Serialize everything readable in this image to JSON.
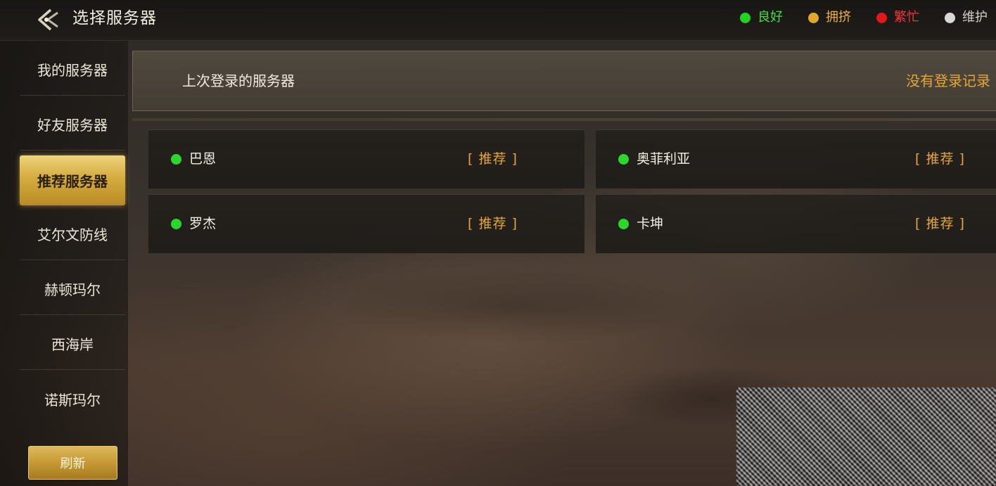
{
  "header": {
    "title": "选择服务器",
    "back_icon": "back-arrow-icon",
    "legend": [
      {
        "label": "良好",
        "color": "#22d422",
        "text_color": "#3fe23f"
      },
      {
        "label": "拥挤",
        "color": "#e0a82a",
        "text_color": "#e8b040"
      },
      {
        "label": "繁忙",
        "color": "#e01818",
        "text_color": "#ee3a3a"
      },
      {
        "label": "维护",
        "color": "#d8d8d8",
        "text_color": "#d4d0c8"
      }
    ]
  },
  "sidebar": {
    "tabs": [
      {
        "label": "我的服务器",
        "active": false
      },
      {
        "label": "好友服务器",
        "active": false
      },
      {
        "label": "推荐服务器",
        "active": true
      },
      {
        "label": "艾尔文防线",
        "active": false
      },
      {
        "label": "赫顿玛尔",
        "active": false
      },
      {
        "label": "西海岸",
        "active": false
      },
      {
        "label": "诺斯玛尔",
        "active": false
      }
    ],
    "refresh_label": "刷新"
  },
  "last_login": {
    "title": "上次登录的服务器",
    "status": "没有登录记录"
  },
  "servers": [
    {
      "name": "巴恩",
      "tag": "[ 推荐 ]",
      "status_color": "#2cd62c"
    },
    {
      "name": "奥菲利亚",
      "tag": "[ 推荐 ]",
      "status_color": "#2cd62c"
    },
    {
      "name": "罗杰",
      "tag": "[ 推荐 ]",
      "status_color": "#2cd62c"
    },
    {
      "name": "卡坤",
      "tag": "[ 推荐 ]",
      "status_color": "#2cd62c"
    }
  ]
}
